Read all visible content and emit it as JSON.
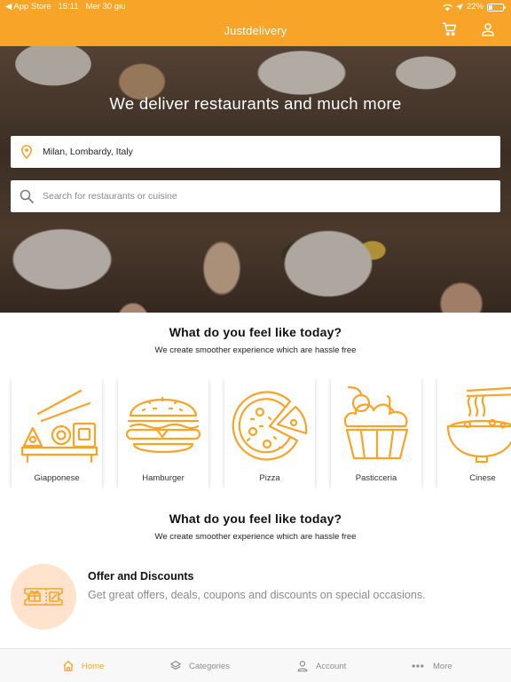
{
  "status_bar": {
    "back_app": "◀ App Store",
    "time": "15:11",
    "date": "Mer 30 giu",
    "battery": "22%"
  },
  "header": {
    "title": "Justdelivery",
    "cart_icon": "cart-icon",
    "account_icon": "user-icon"
  },
  "hero": {
    "title": "We deliver restaurants and much more",
    "location_value": "Milan, Lombardy, Italy",
    "search_placeholder": "Search for restaurants or cuisine"
  },
  "categories_section": {
    "title": "What do you feel like today?",
    "subtitle": "We create smoother experience which are hassle free",
    "items": [
      {
        "label": "Giapponese",
        "icon": "sushi-icon"
      },
      {
        "label": "Hamburger",
        "icon": "hamburger-icon"
      },
      {
        "label": "Pizza",
        "icon": "pizza-icon"
      },
      {
        "label": "Pasticceria",
        "icon": "cupcake-icon"
      },
      {
        "label": "Cinese",
        "icon": "noodles-icon"
      }
    ]
  },
  "offers_section": {
    "title": "What do you feel like today?",
    "subtitle": "We create smoother experience which are hassle free",
    "offer": {
      "title": "Offer and Discounts",
      "description": "Get great offers, deals, coupons and discounts on special occasions.",
      "icon": "gift-ticket-icon"
    }
  },
  "tabbar": {
    "items": [
      {
        "label": "Home",
        "icon": "home-icon",
        "active": true
      },
      {
        "label": "Categories",
        "icon": "layers-icon",
        "active": false
      },
      {
        "label": "Account",
        "icon": "user-icon",
        "active": false
      },
      {
        "label": "More",
        "icon": "more-dots-icon",
        "active": false
      }
    ]
  },
  "colors": {
    "accent": "#F7A429",
    "offer_badge_bg": "#FFE3CC",
    "tab_inactive": "#8E8E8E"
  }
}
